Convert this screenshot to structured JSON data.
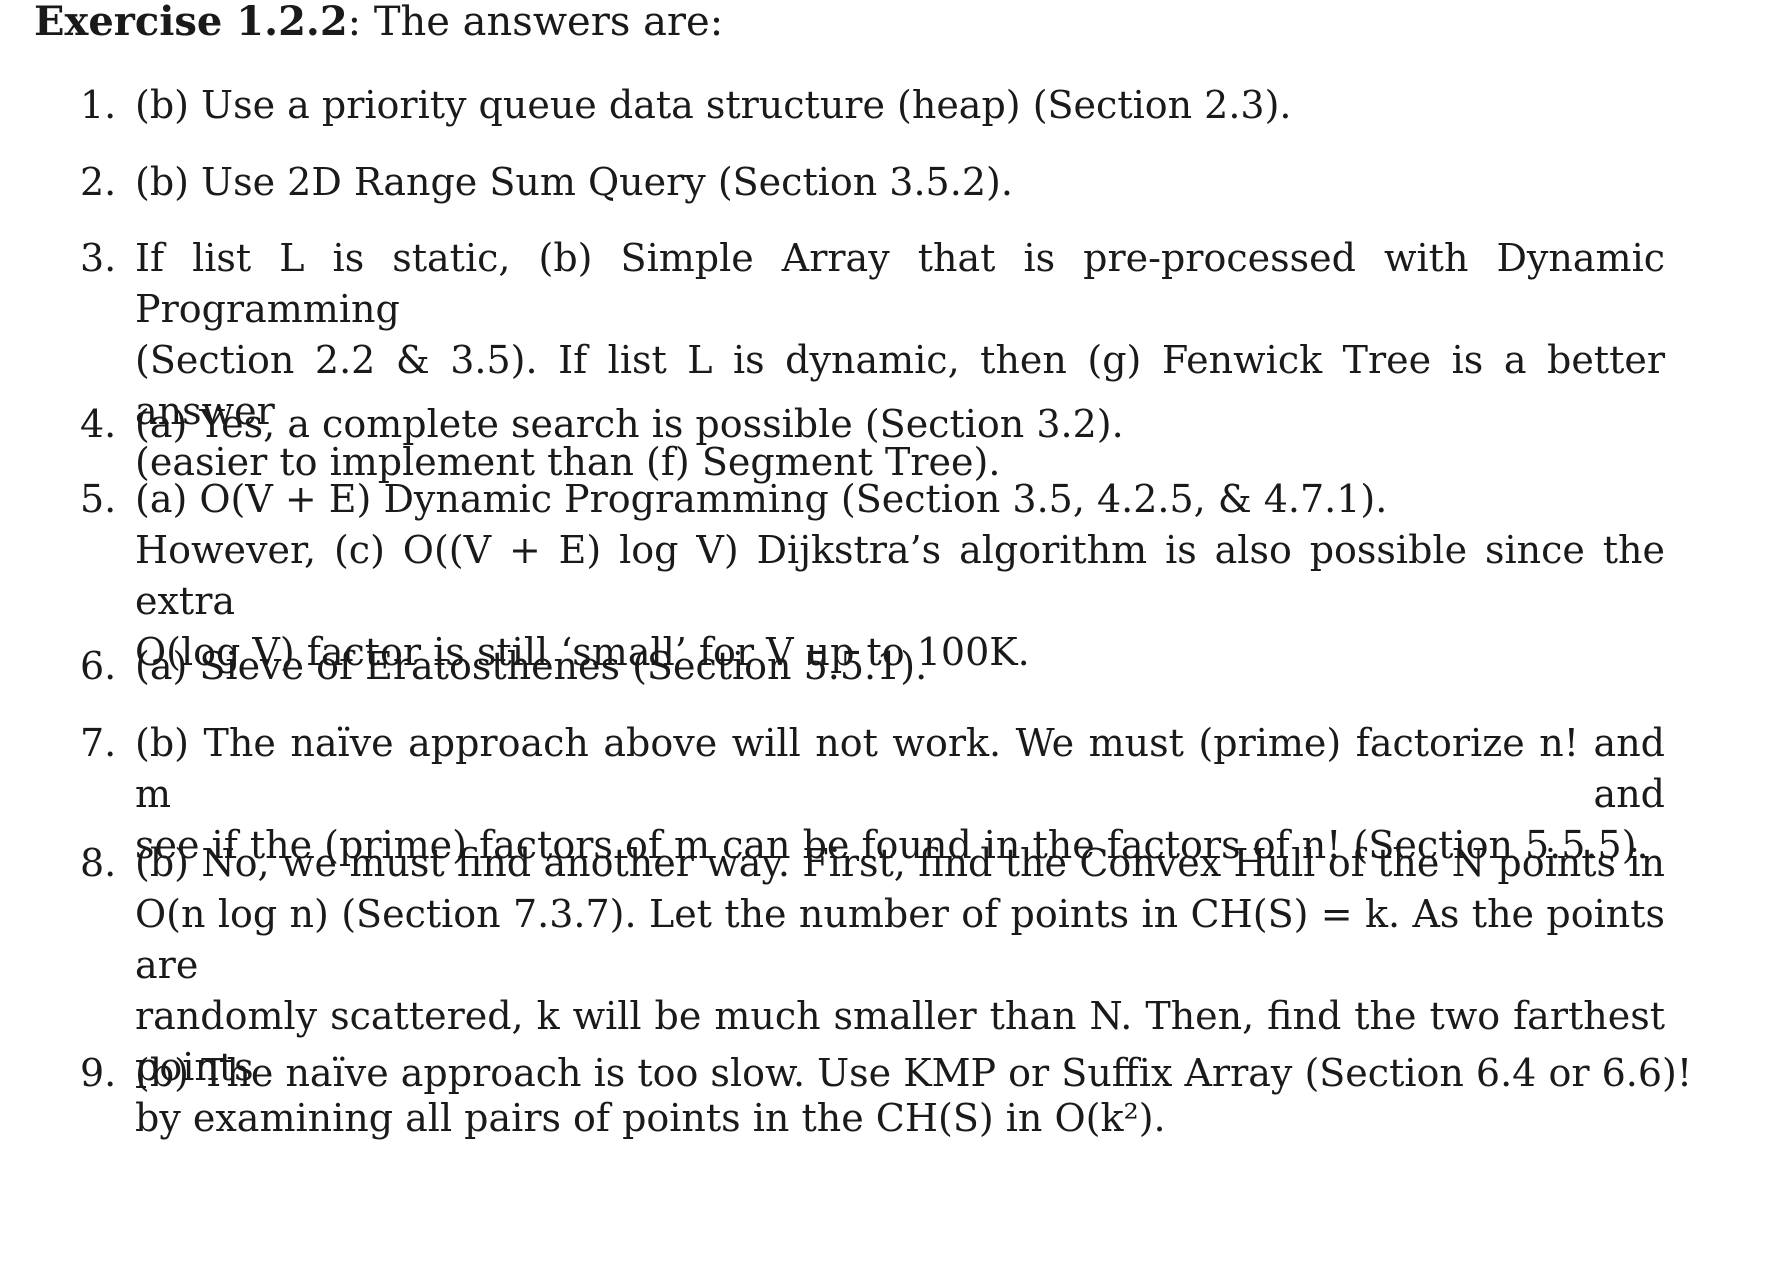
{
  "heading": {
    "label": "Exercise 1.2.2",
    "text": ": The answers are:"
  },
  "answers": [
    {
      "number": "1.",
      "lines": [
        "(b) Use a priority queue data structure (heap) (Section 2.3)."
      ]
    },
    {
      "number": "2.",
      "lines": [
        "(b) Use 2D Range Sum Query (Section 3.5.2)."
      ]
    },
    {
      "number": "3.",
      "lines": [
        "If list L is static, (b) Simple Array that is pre-processed with Dynamic Programming",
        "(Section 2.2 & 3.5). If list L is dynamic, then (g) Fenwick Tree is a better answer",
        "(easier to implement than (f) Segment Tree)."
      ]
    },
    {
      "number": "4.",
      "lines": [
        "(a) Yes, a complete search is possible (Section 3.2)."
      ]
    },
    {
      "number": "5.",
      "lines": [
        "(a) O(V + E) Dynamic Programming (Section 3.5, 4.2.5, & 4.7.1).",
        "However, (c) O((V + E) log V) Dijkstra’s algorithm is also possible since the extra",
        "O(log V) factor is still ‘small’ for V up to 100K."
      ]
    },
    {
      "number": "6.",
      "lines": [
        "(a) Sieve of Eratosthenes (Section 5.5.1)."
      ]
    },
    {
      "number": "7.",
      "lines": [
        "(b) The naïve approach above will not work. We must (prime) factorize n! and m and",
        "see if the (prime) factors of m can be found in the factors of n! (Section 5.5.5)."
      ]
    },
    {
      "number": "8.",
      "lines": [
        "(b) No, we must find another way. First, find the Convex Hull of the N points in",
        "O(n log n) (Section 7.3.7). Let the number of points in CH(S) = k. As the points are",
        "randomly scattered, k will be much smaller than N. Then, find the two farthest points",
        "by examining all pairs of points in the CH(S) in O(k²)."
      ]
    },
    {
      "number": "9.",
      "lines": [
        "(b) The naïve approach is too slow. Use KMP or Suffix Array (Section 6.4 or 6.6)!"
      ]
    }
  ]
}
